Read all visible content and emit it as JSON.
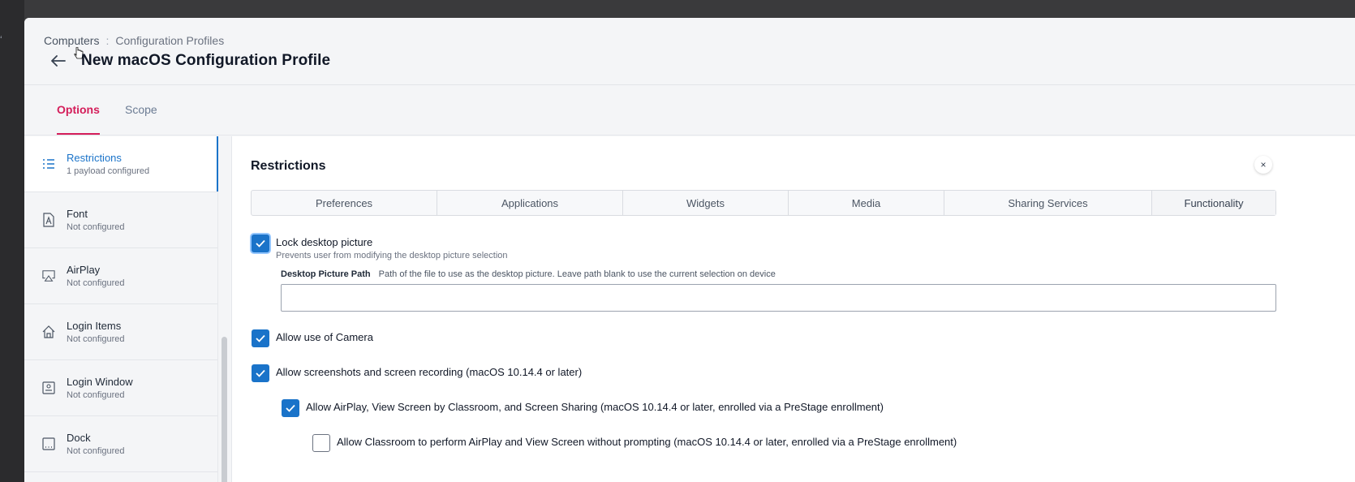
{
  "breadcrumb": {
    "root": "Computers",
    "separator": ":",
    "current": "Configuration Profiles"
  },
  "page": {
    "title": "New macOS Configuration Profile"
  },
  "tabs": [
    {
      "label": "Options",
      "active": true
    },
    {
      "label": "Scope",
      "active": false
    }
  ],
  "sidebar": {
    "items": [
      {
        "title": "Restrictions",
        "subtitle": "1 payload configured",
        "icon": "restrictions-list-icon",
        "active": true
      },
      {
        "title": "Font",
        "subtitle": "Not configured",
        "icon": "font-icon"
      },
      {
        "title": "AirPlay",
        "subtitle": "Not configured",
        "icon": "airplay-icon"
      },
      {
        "title": "Login Items",
        "subtitle": "Not configured",
        "icon": "house-icon"
      },
      {
        "title": "Login Window",
        "subtitle": "Not configured",
        "icon": "login-window-icon"
      },
      {
        "title": "Dock",
        "subtitle": "Not configured",
        "icon": "dock-icon"
      }
    ]
  },
  "panel": {
    "title": "Restrictions",
    "close_label": "×",
    "segments": [
      "Preferences",
      "Applications",
      "Widgets",
      "Media",
      "Sharing Services",
      "Functionality"
    ],
    "options": {
      "lock_desktop": {
        "label": "Lock desktop picture",
        "description": "Prevents user from modifying the desktop picture selection",
        "checked": true
      },
      "desktop_path": {
        "label": "Desktop Picture Path",
        "help": "Path of the file to use as the desktop picture. Leave path blank to use the current selection on device",
        "value": ""
      },
      "camera": {
        "label": "Allow use of Camera",
        "checked": true
      },
      "screenshots": {
        "label": "Allow screenshots and screen recording (macOS 10.14.4 or later)",
        "checked": true
      },
      "airplay_classroom": {
        "label": "Allow AirPlay, View Screen by Classroom, and Screen Sharing (macOS 10.14.4 or later, enrolled via a PreStage enrollment)",
        "checked": true
      },
      "classroom_no_prompt": {
        "label": "Allow Classroom to perform AirPlay and View Screen without prompting (macOS 10.14.4 or later, enrolled via a PreStage enrollment)",
        "checked": false
      }
    }
  },
  "colors": {
    "accent": "#d41d5a",
    "primary": "#1a73c9"
  }
}
